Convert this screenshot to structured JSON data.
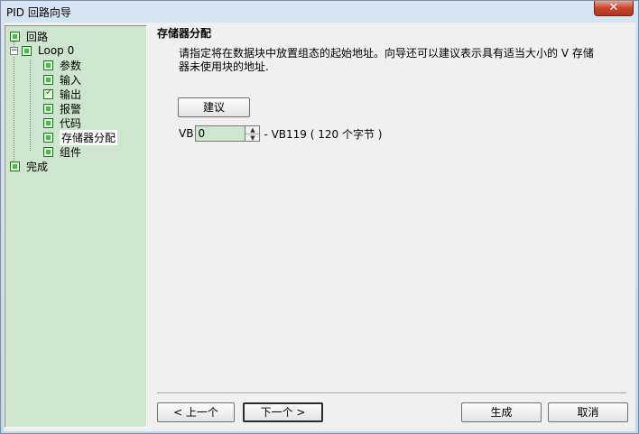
{
  "window": {
    "title": "PID 回路向导",
    "close_glyph": "✕"
  },
  "tree": {
    "root": "回路",
    "loop": "Loop 0",
    "children": [
      "参数",
      "输入",
      "输出",
      "报警",
      "代码",
      "存储器分配",
      "组件"
    ],
    "finish": "完成",
    "checked_child": "输出",
    "selected_child": "存储器分配"
  },
  "panel": {
    "title": "存储器分配",
    "description": "请指定将在数据块中放置组态的起始地址。向导还可以建议表示具有适当大小的 V 存储器未使用块的地址.",
    "suggest_button": "建议",
    "vb_label": "VB",
    "vb_value": "0",
    "vb_range": "- VB119 ( 120 个字节 )"
  },
  "footer": {
    "prev": "< 上一个",
    "next": "下一个 >",
    "generate": "生成",
    "cancel": "取消"
  },
  "colors": {
    "tree_bg": "#cde6cd",
    "checkbox_green": "#3ec43e",
    "close_red": "#c9452b"
  },
  "icons": {
    "close": "close-icon",
    "checkbox": "checkbox-icon",
    "expander": "collapse-icon",
    "spin": "spin-arrows-icon"
  }
}
